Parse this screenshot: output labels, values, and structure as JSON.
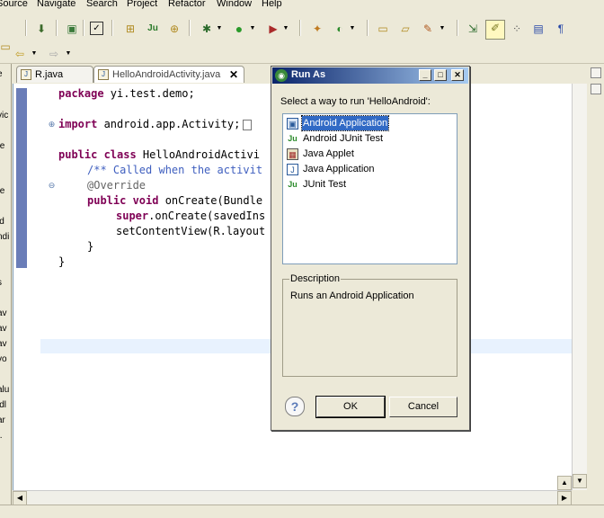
{
  "menubar": {
    "items": [
      {
        "label": "Source"
      },
      {
        "label": "Navigate"
      },
      {
        "label": "Search"
      },
      {
        "label": "Project"
      },
      {
        "label": "Refactor"
      },
      {
        "label": "Window"
      },
      {
        "label": "Help"
      }
    ]
  },
  "editor": {
    "tabs": [
      {
        "label": "R.java",
        "active": false
      },
      {
        "label": "HelloAndroidActivity.java",
        "active": true,
        "close": "✕"
      }
    ],
    "code": {
      "line1_kw": "package",
      "line1_rest": " yi.test.demo;",
      "line2_kw": "import",
      "line2_rest": " android.app.Activity;",
      "line3_kw": "public class",
      "line3_rest": " HelloAndroidActivi",
      "line4_comment": "/** Called when the activit",
      "line5_annot": "@Override",
      "line6_kw": "public void",
      "line6_rest": " onCreate(Bundle",
      "line7_kw": "super",
      "line7_rest": ".onCreate(savedIns",
      "line8": "setContentView(R.layout",
      "line9": "}",
      "line10": "}"
    }
  },
  "dialog": {
    "title": "Run As",
    "prompt": "Select a way to run 'HelloAndroid':",
    "options": [
      {
        "label": "Android Application",
        "icon": "android-app-icon",
        "selected": true
      },
      {
        "label": "Android JUnit Test",
        "icon": "junit-icon"
      },
      {
        "label": "Java Applet",
        "icon": "applet-icon"
      },
      {
        "label": "Java Application",
        "icon": "java-app-icon"
      },
      {
        "label": "JUnit Test",
        "icon": "junit-icon"
      }
    ],
    "description_label": "Description",
    "description_text": "Runs an Android Application",
    "ok_label": "OK",
    "cancel_label": "Cancel",
    "help_glyph": "?"
  },
  "left_strip": {
    "texts": [
      "e",
      "vic",
      "te",
      "te",
      "id",
      "ndi",
      "s",
      "av",
      "av",
      "av",
      "vo",
      "alu",
      "idl",
      "ar",
      "t."
    ]
  },
  "colors": {
    "titlebar_start": "#0a246a",
    "selection": "#316ac5",
    "keyword": "#7f0055",
    "comment": "#3f5fbf"
  }
}
